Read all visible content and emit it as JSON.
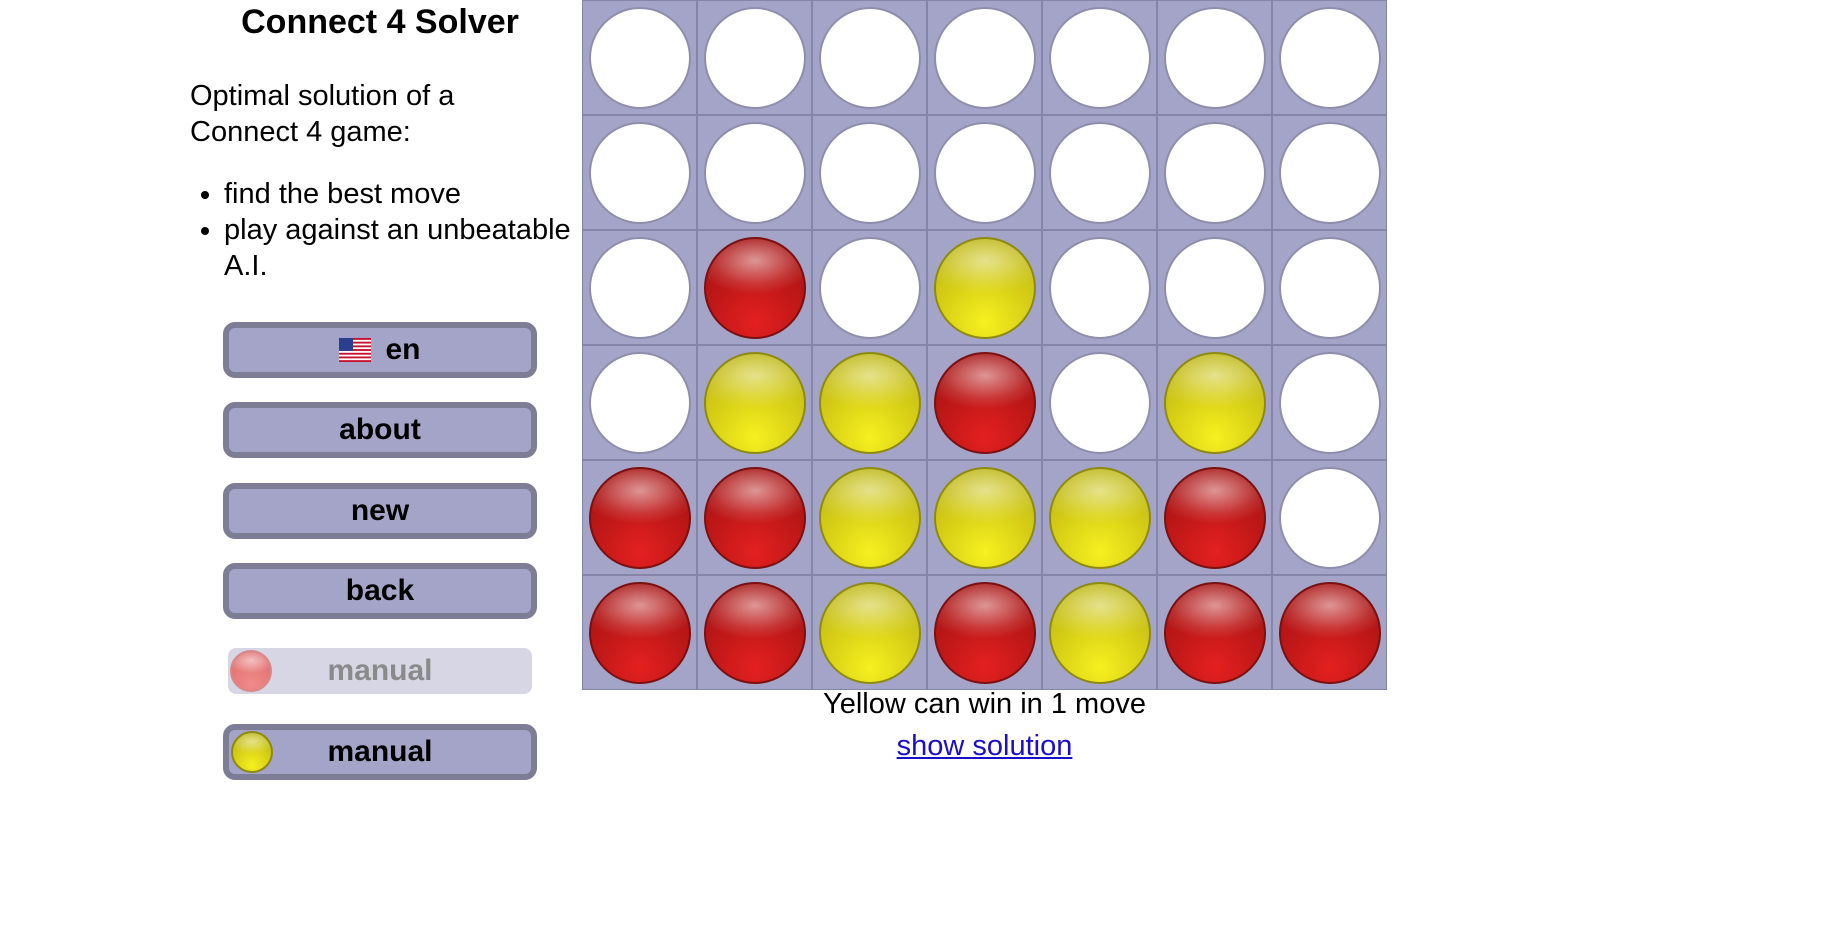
{
  "app": {
    "title": "Connect 4 Solver"
  },
  "intro": {
    "text": "Optimal solution of a Connect 4 game:",
    "features": [
      "find the best move",
      "play against an unbeatable A.I."
    ]
  },
  "menu": {
    "language_label": "en",
    "language_flag": "us-flag-icon",
    "about_label": "about",
    "new_label": "new",
    "back_label": "back",
    "red_player_label": "manual",
    "yellow_player_label": "manual"
  },
  "board": {
    "columns": 7,
    "rows": 6,
    "cells": [
      [
        "empty",
        "empty",
        "empty",
        "empty",
        "empty",
        "empty",
        "empty"
      ],
      [
        "empty",
        "empty",
        "empty",
        "empty",
        "empty",
        "empty",
        "empty"
      ],
      [
        "empty",
        "red",
        "empty",
        "yellow",
        "empty",
        "empty",
        "empty"
      ],
      [
        "empty",
        "yellow",
        "yellow",
        "red",
        "empty",
        "yellow",
        "empty"
      ],
      [
        "red",
        "red",
        "yellow",
        "yellow",
        "yellow",
        "red",
        "empty"
      ],
      [
        "red",
        "red",
        "yellow",
        "red",
        "yellow",
        "red",
        "red"
      ]
    ]
  },
  "status": {
    "message": "Yellow can win in 1 move",
    "solution_link": "show solution"
  },
  "colors": {
    "red": "#c81818",
    "yellow": "#e0d818",
    "board": "#a4a4c8",
    "button": "#a4a4c8",
    "button_border": "#7d7d96",
    "link": "#1a0dcc"
  }
}
